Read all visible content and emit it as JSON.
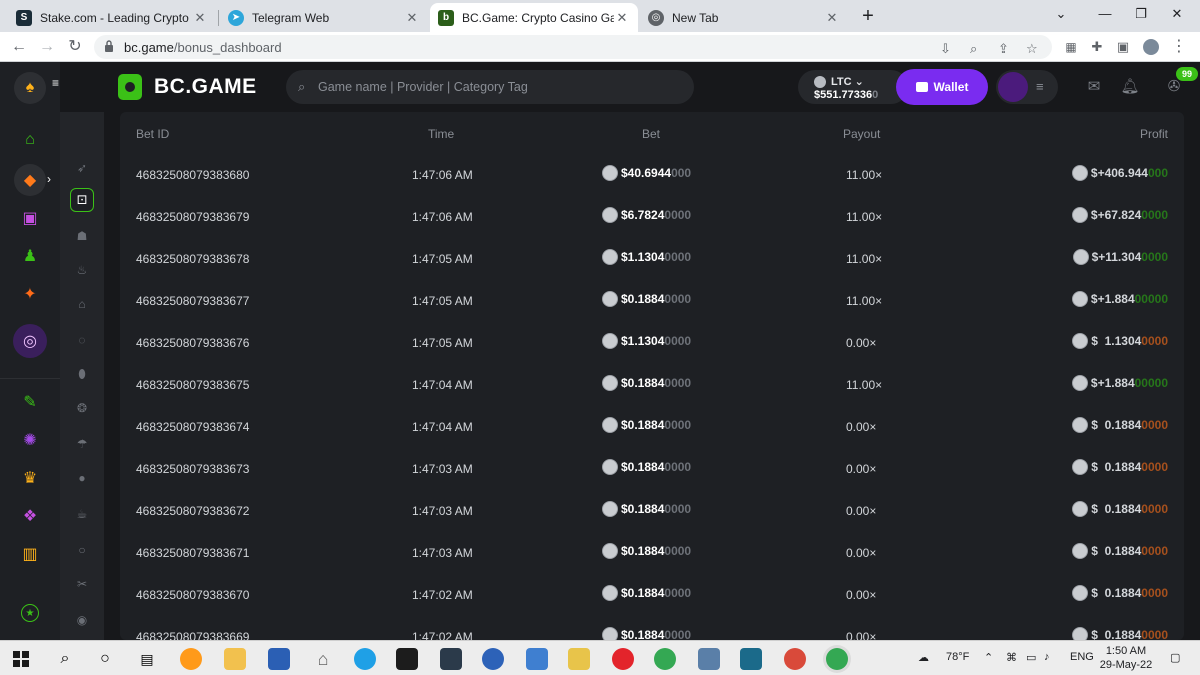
{
  "browser": {
    "tabs": [
      {
        "title": "Stake.com - Leading Crypto Casi",
        "active": false,
        "favicon_color": "#1a2c38"
      },
      {
        "title": "Telegram Web",
        "active": false,
        "favicon_color": "#2ea6da"
      },
      {
        "title": "BC.Game: Crypto Casino Games",
        "active": true,
        "favicon_color": "#2c5e1a"
      },
      {
        "title": "New Tab",
        "active": false,
        "favicon_color": "#5f6368"
      }
    ],
    "url_host": "bc.game",
    "url_path": "/bonus_dashboard"
  },
  "header": {
    "logo_text": "BC.GAME",
    "search_placeholder": "Game name | Provider | Category Tag",
    "currency": "LTC",
    "balance_main": "$551.77336",
    "balance_dim": "0",
    "wallet_label": "Wallet",
    "chat_badge": "99"
  },
  "table": {
    "headers": {
      "bet_id": "Bet ID",
      "time": "Time",
      "bet": "Bet",
      "payout": "Payout",
      "profit": "Profit"
    },
    "rows": [
      {
        "id": "46832508079383680",
        "time": "1:47:06 AM",
        "bet": "$40.6944",
        "bet_dim": "000",
        "payout": "11.00×",
        "profit": "$+406.944",
        "profit_dim": "000",
        "win": true
      },
      {
        "id": "46832508079383679",
        "time": "1:47:06 AM",
        "bet": "$6.7824",
        "bet_dim": "0000",
        "payout": "11.00×",
        "profit": "$+67.824",
        "profit_dim": "0000",
        "win": true
      },
      {
        "id": "46832508079383678",
        "time": "1:47:05 AM",
        "bet": "$1.1304",
        "bet_dim": "0000",
        "payout": "11.00×",
        "profit": "$+11.304",
        "profit_dim": "0000",
        "win": true
      },
      {
        "id": "46832508079383677",
        "time": "1:47:05 AM",
        "bet": "$0.1884",
        "bet_dim": "0000",
        "payout": "11.00×",
        "profit": "$+1.884",
        "profit_dim": "00000",
        "win": true
      },
      {
        "id": "46832508079383676",
        "time": "1:47:05 AM",
        "bet": "$1.1304",
        "bet_dim": "0000",
        "payout": "0.00×",
        "profit": "$  1.1304",
        "profit_dim": "0000",
        "win": false
      },
      {
        "id": "46832508079383675",
        "time": "1:47:04 AM",
        "bet": "$0.1884",
        "bet_dim": "0000",
        "payout": "11.00×",
        "profit": "$+1.884",
        "profit_dim": "00000",
        "win": true
      },
      {
        "id": "46832508079383674",
        "time": "1:47:04 AM",
        "bet": "$0.1884",
        "bet_dim": "0000",
        "payout": "0.00×",
        "profit": "$  0.1884",
        "profit_dim": "0000",
        "win": false
      },
      {
        "id": "46832508079383673",
        "time": "1:47:03 AM",
        "bet": "$0.1884",
        "bet_dim": "0000",
        "payout": "0.00×",
        "profit": "$  0.1884",
        "profit_dim": "0000",
        "win": false
      },
      {
        "id": "46832508079383672",
        "time": "1:47:03 AM",
        "bet": "$0.1884",
        "bet_dim": "0000",
        "payout": "0.00×",
        "profit": "$  0.1884",
        "profit_dim": "0000",
        "win": false
      },
      {
        "id": "46832508079383671",
        "time": "1:47:03 AM",
        "bet": "$0.1884",
        "bet_dim": "0000",
        "payout": "0.00×",
        "profit": "$  0.1884",
        "profit_dim": "0000",
        "win": false
      },
      {
        "id": "46832508079383670",
        "time": "1:47:02 AM",
        "bet": "$0.1884",
        "bet_dim": "0000",
        "payout": "0.00×",
        "profit": "$  0.1884",
        "profit_dim": "0000",
        "win": false
      },
      {
        "id": "46832508079383669",
        "time": "1:47:02 AM",
        "bet": "$0.1884",
        "bet_dim": "0000",
        "payout": "0.00×",
        "profit": "$  0.1884",
        "profit_dim": "0000",
        "win": false
      }
    ]
  },
  "taskbar": {
    "weather": "78°F",
    "language": "ENG",
    "time": "1:50 AM",
    "date": "29-May-22"
  },
  "colors": {
    "accent_green": "#3bc117",
    "loss_orange": "#ff6b18",
    "wallet_purple": "#7a2cf0"
  }
}
